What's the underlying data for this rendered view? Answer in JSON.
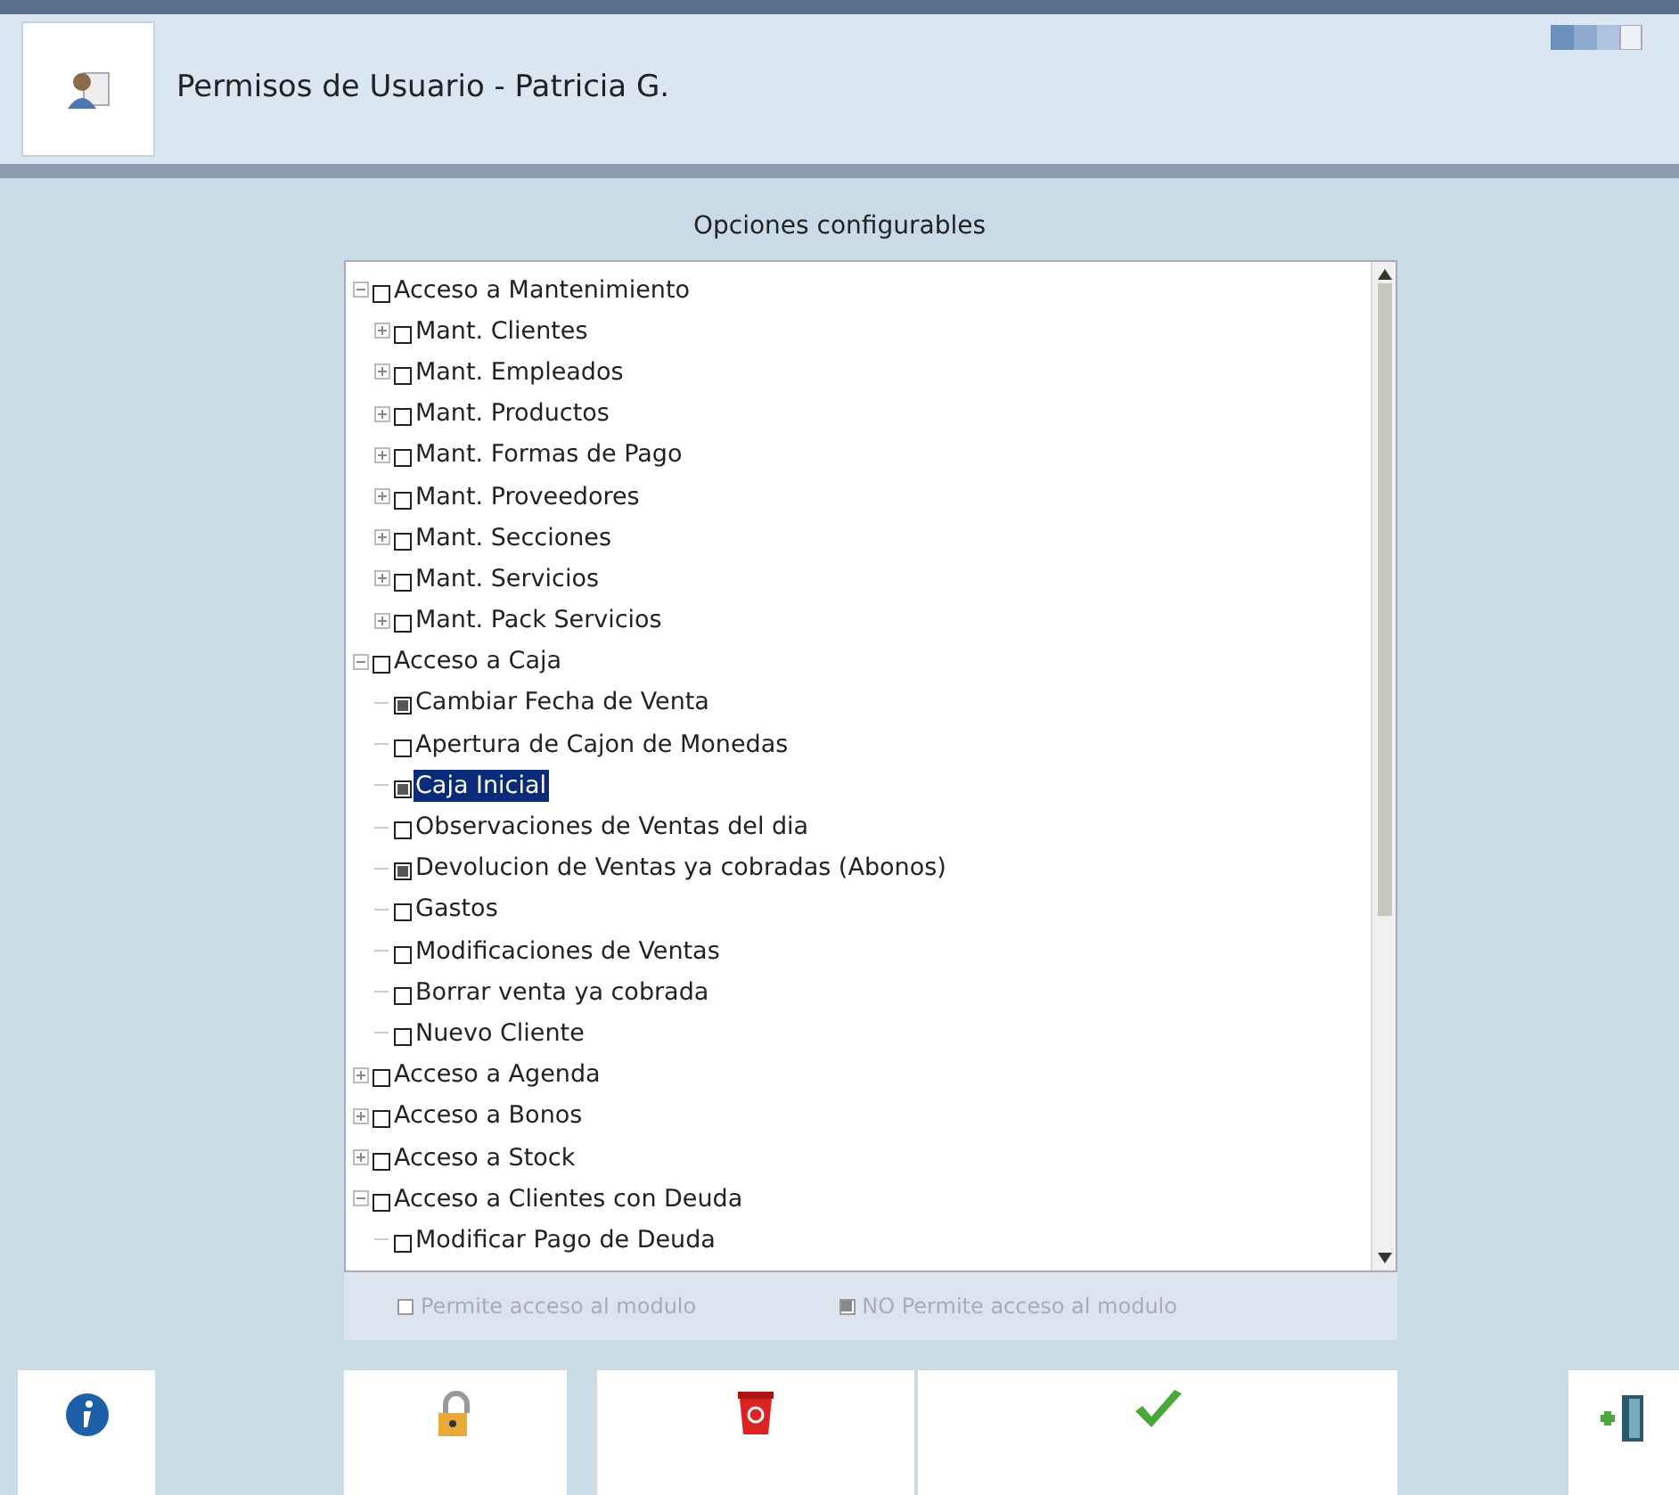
{
  "window": {
    "title": "Permisos de Usuario - Patricia G."
  },
  "panel_title": "Opciones configurables",
  "tree": [
    {
      "label": "Acceso a Mantenimiento",
      "checked": false,
      "selected": false,
      "expanded": true,
      "children": [
        {
          "label": "Mant. Clientes",
          "checked": false,
          "selected": false,
          "expanded": false
        },
        {
          "label": "Mant. Empleados",
          "checked": false,
          "selected": false,
          "expanded": false
        },
        {
          "label": "Mant. Productos",
          "checked": false,
          "selected": false,
          "expanded": false
        },
        {
          "label": "Mant. Formas de Pago",
          "checked": false,
          "selected": false,
          "expanded": false
        },
        {
          "label": "Mant. Proveedores",
          "checked": false,
          "selected": false,
          "expanded": false
        },
        {
          "label": "Mant. Secciones",
          "checked": false,
          "selected": false,
          "expanded": false
        },
        {
          "label": "Mant. Servicios",
          "checked": false,
          "selected": false,
          "expanded": false
        },
        {
          "label": "Mant. Pack Servicios",
          "checked": false,
          "selected": false,
          "expanded": false
        }
      ]
    },
    {
      "label": "Acceso a Caja",
      "checked": false,
      "selected": false,
      "expanded": true,
      "children": [
        {
          "label": "Cambiar Fecha de Venta",
          "checked": true,
          "selected": false
        },
        {
          "label": "Apertura de Cajon de Monedas",
          "checked": false,
          "selected": false
        },
        {
          "label": "Caja Inicial",
          "checked": true,
          "selected": true
        },
        {
          "label": "Observaciones de Ventas del dia",
          "checked": false,
          "selected": false
        },
        {
          "label": "Devolucion de Ventas ya cobradas (Abonos)",
          "checked": true,
          "selected": false
        },
        {
          "label": "Gastos",
          "checked": false,
          "selected": false
        },
        {
          "label": "Modificaciones de Ventas",
          "checked": false,
          "selected": false
        },
        {
          "label": "Borrar venta ya cobrada",
          "checked": false,
          "selected": false
        },
        {
          "label": "Nuevo Cliente",
          "checked": false,
          "selected": false
        }
      ]
    },
    {
      "label": "Acceso a Agenda",
      "checked": false,
      "selected": false,
      "expanded": false
    },
    {
      "label": "Acceso a Bonos",
      "checked": false,
      "selected": false,
      "expanded": false
    },
    {
      "label": "Acceso a Stock",
      "checked": false,
      "selected": false,
      "expanded": false
    },
    {
      "label": "Acceso a Clientes con Deuda",
      "checked": false,
      "selected": false,
      "expanded": true,
      "children": [
        {
          "label": "Modificar Pago de Deuda",
          "checked": false,
          "selected": false
        }
      ]
    }
  ],
  "legend": [
    {
      "label": "Permite acceso al modulo",
      "checked": false
    },
    {
      "label": "NO Permite acceso al modulo",
      "checked": true
    }
  ]
}
